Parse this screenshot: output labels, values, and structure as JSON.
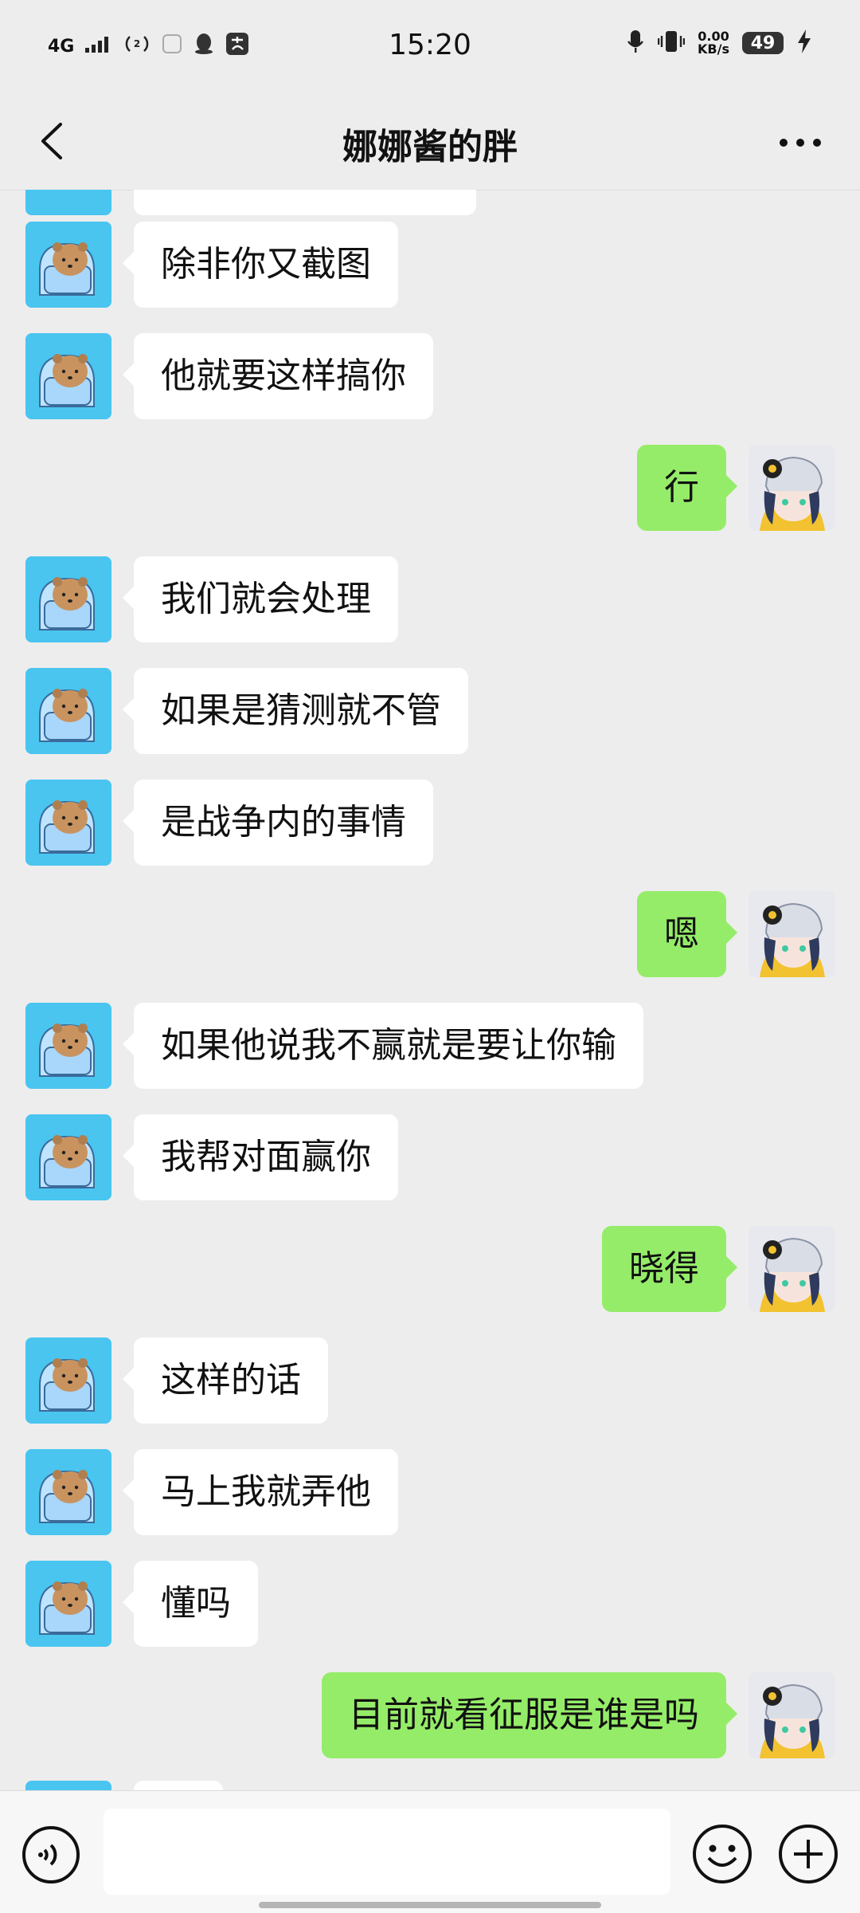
{
  "status_bar": {
    "network": "4G",
    "time": "15:20",
    "net_speed_value": "0.00",
    "net_speed_unit": "KB/s",
    "battery": "49"
  },
  "header": {
    "title": "娜娜酱的胖",
    "back_icon": "chevron-left-icon",
    "more_icon": "more-dots-icon"
  },
  "messages": [
    {
      "side": "left",
      "text": "除非你又截图"
    },
    {
      "side": "left",
      "text": "他就要这样搞你"
    },
    {
      "side": "right",
      "text": "行"
    },
    {
      "side": "left",
      "text": "我们就会处理"
    },
    {
      "side": "left",
      "text": "如果是猜测就不管"
    },
    {
      "side": "left",
      "text": "是战争内的事情"
    },
    {
      "side": "right",
      "text": "嗯"
    },
    {
      "side": "left",
      "text": "如果他说我不赢就是要让你输"
    },
    {
      "side": "left",
      "text": "我帮对面赢你"
    },
    {
      "side": "right",
      "text": "晓得"
    },
    {
      "side": "left",
      "text": "这样的话"
    },
    {
      "side": "left",
      "text": "马上我就弄他"
    },
    {
      "side": "left",
      "text": "懂吗"
    },
    {
      "side": "right",
      "text": "目前就看征服是谁是吗"
    }
  ],
  "input_bar": {
    "placeholder": "",
    "voice_icon": "voice-icon",
    "emoji_icon": "emoji-icon",
    "plus_icon": "plus-circle-icon"
  },
  "colors": {
    "background": "#ededed",
    "bubble_self": "#95ec69",
    "bubble_other": "#ffffff",
    "avatar_other_bg": "#49c5f0"
  }
}
